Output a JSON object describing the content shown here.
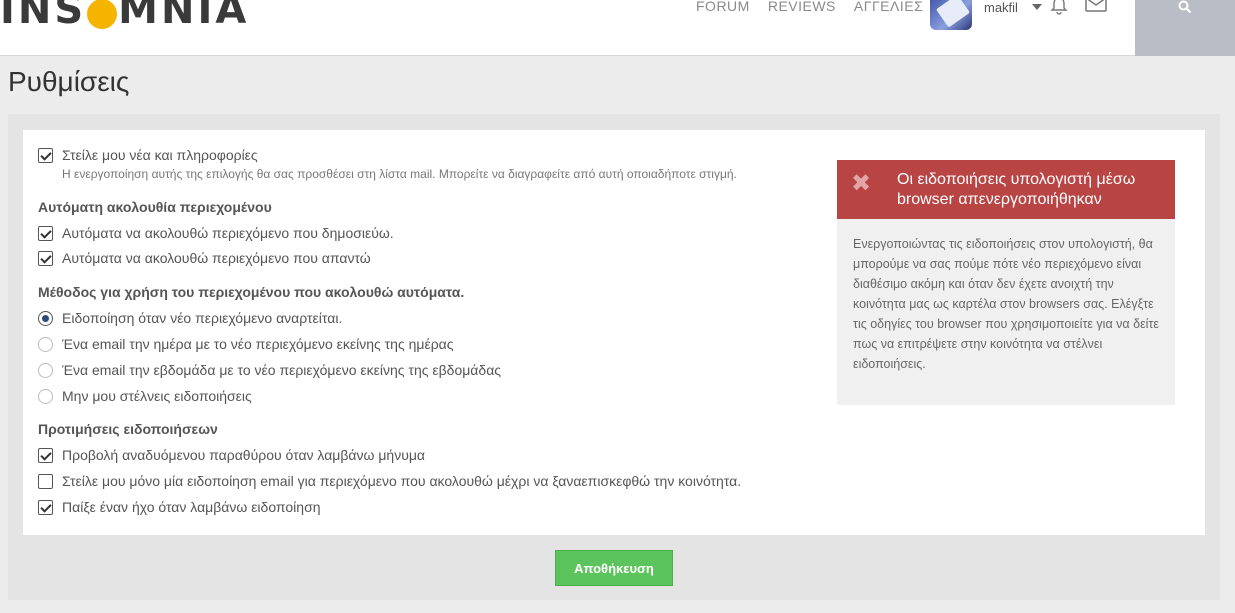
{
  "header": {
    "logo_left": "INS",
    "logo_right": "MNIA",
    "nav": [
      "FORUM",
      "REVIEWS",
      "ΑΓΓΕΛΙΕΣ"
    ],
    "username": "makfil"
  },
  "page_title": "Ρυθμίσεις",
  "newsletter": {
    "label": "Στείλε μου νέα και πληροφορίες",
    "checked": true,
    "hint": "Η ενεργοποίηση αυτής της επιλογής θα σας προσθέσει στη λίστα mail. Μπορείτε να διαγραφείτε από αυτή οποιαδήποτε στιγμή."
  },
  "auto_follow": {
    "heading": "Αυτόματη ακολουθία περιεχομένου",
    "options": [
      {
        "label": "Αυτόματα να ακολουθώ περιεχόμενο που δημοσιεύω.",
        "checked": true
      },
      {
        "label": "Αυτόματα να ακολουθώ περιεχόμενο που απαντώ",
        "checked": true
      }
    ]
  },
  "method": {
    "heading": "Μέθοδος για χρήση του περιεχομένου που ακολουθώ αυτόματα.",
    "options": [
      {
        "label": "Ειδοποίηση όταν νέο περιεχόμενο αναρτείται.",
        "selected": true
      },
      {
        "label": "Ένα email την ημέρα με το νέο περιεχόμενο εκείνης της ημέρας",
        "selected": false
      },
      {
        "label": "Ένα email την εβδομάδα με το νέο περιεχόμενο εκείνης της εβδομάδας",
        "selected": false
      },
      {
        "label": "Μην μου στέλνεις ειδοποιήσεις",
        "selected": false
      }
    ]
  },
  "notif_prefs": {
    "heading": "Προτιμήσεις ειδοποιήσεων",
    "options": [
      {
        "label": "Προβολή αναδυόμενου παραθύρου όταν λαμβάνω μήνυμα",
        "checked": true
      },
      {
        "label": "Στείλε μου μόνο μία ειδοποίηση email για περιεχόμενο που ακολουθώ μέχρι να ξαναεπισκεφθώ την κοινότητα.",
        "checked": false
      },
      {
        "label": "Παίξε έναν ήχο όταν λαμβάνω ειδοποίηση",
        "checked": true
      }
    ]
  },
  "alert": {
    "title": "Οι ειδοποιήσεις υπολογιστή μέσω browser απενεργοποιήθηκαν",
    "body": "Ενεργοποιώντας τις ειδοποιήσεις στον υπολογιστή, θα μπορούμε να σας πούμε πότε νέο περιεχόμενο είναι διαθέσιμο ακόμη και όταν δεν έχετε ανοιχτή την κοινότητα μας ως καρτέλα στον browsers σας. Ελέγξτε τις οδηγίες του browser που χρησιμοποιείτε για να δείτε πως να επιτρέψετε στην κοινότητα να στέλνει ειδοποιήσεις.",
    "color": "#b84444"
  },
  "save_label": "Αποθήκευση",
  "colors": {
    "save": "#5cc45c"
  }
}
